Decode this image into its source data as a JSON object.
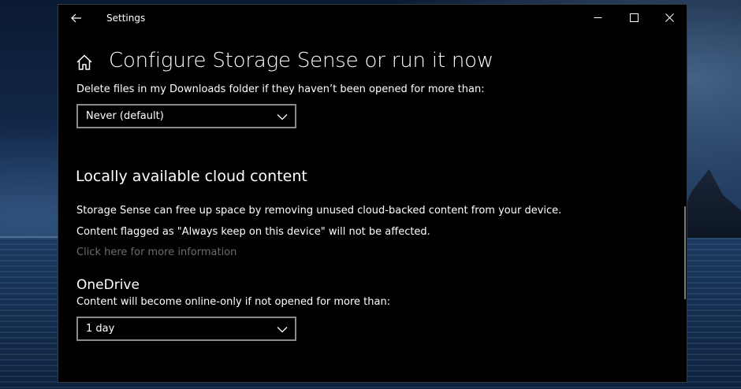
{
  "window": {
    "title": "Settings"
  },
  "page": {
    "title": "Configure Storage Sense or run it now"
  },
  "downloads": {
    "label": "Delete files in my Downloads folder if they haven’t been opened for more than:",
    "selected": "Never (default)"
  },
  "cloud": {
    "heading": "Locally available cloud content",
    "description1": "Storage Sense can free up space by removing unused cloud-backed content from your device.",
    "description2": "Content flagged as \"Always keep on this device\" will not be affected.",
    "link": "Click here for more information"
  },
  "onedrive": {
    "heading": "OneDrive",
    "label": "Content will become online-only if not opened for more than:",
    "selected": "1 day"
  },
  "icons": {
    "back": "back-arrow-icon",
    "minimize": "minimize-icon",
    "maximize": "maximize-icon",
    "close": "close-icon",
    "home": "home-icon",
    "dropdown": "chevron-down-icon"
  },
  "colors": {
    "window_bg": "#000000",
    "text": "#ffffff",
    "link": "#6c6c6c",
    "select_border": "#8a8a8a"
  }
}
